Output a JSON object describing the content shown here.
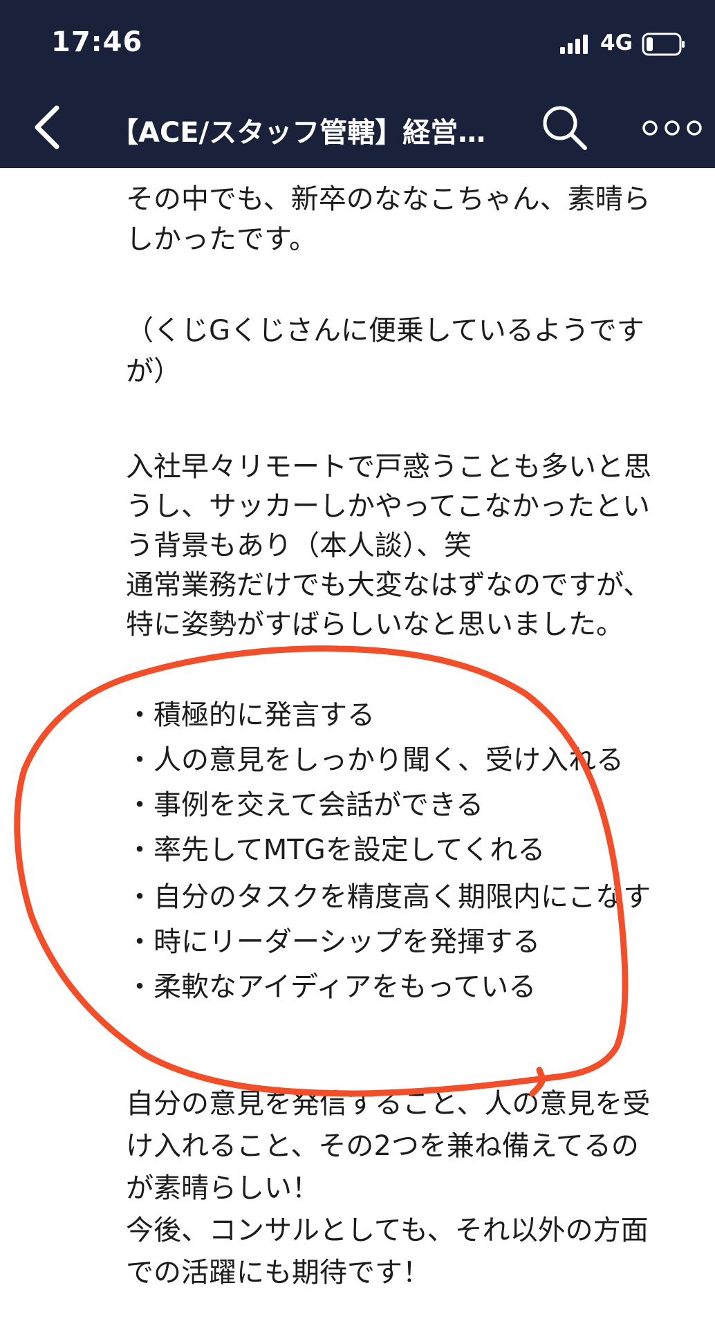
{
  "status_bar": {
    "time": "17:46",
    "network": "4G"
  },
  "nav": {
    "title": "【ACE/スタッフ管轄】経営…"
  },
  "message": {
    "lines": [
      "その中でも、新卒のななこちゃん、素晴ら",
      "しかったです。",
      "（くじGくじさんに便乗しているようです",
      "が）",
      "入社早々リモートで戸惑うことも多いと思",
      "うし、サッカーしかやってこなかったとい",
      "う背景もあり（本人談）、笑",
      "通常業務だけでも大変なはずなのですが、",
      "特に姿勢がすばらしいなと思いました。",
      "・積極的に発言する",
      "・人の意見をしっかり聞く、受け入れる",
      "・事例を交えて会話ができる",
      "・率先してMTGを設定してくれる",
      "・自分のタスクを精度高く期限内にこなす",
      "・時にリーダーシップを発揮する",
      "・柔軟なアイディアをもっている",
      "自分の意見を発信すること、人の意見を受",
      "け入れること、その2つを兼ね備えてるの",
      "が素晴らしい！",
      "今後、コンサルとしても、それ以外の方面",
      "での活躍にも期待です！"
    ]
  },
  "annotation_color": "#f24e2a"
}
